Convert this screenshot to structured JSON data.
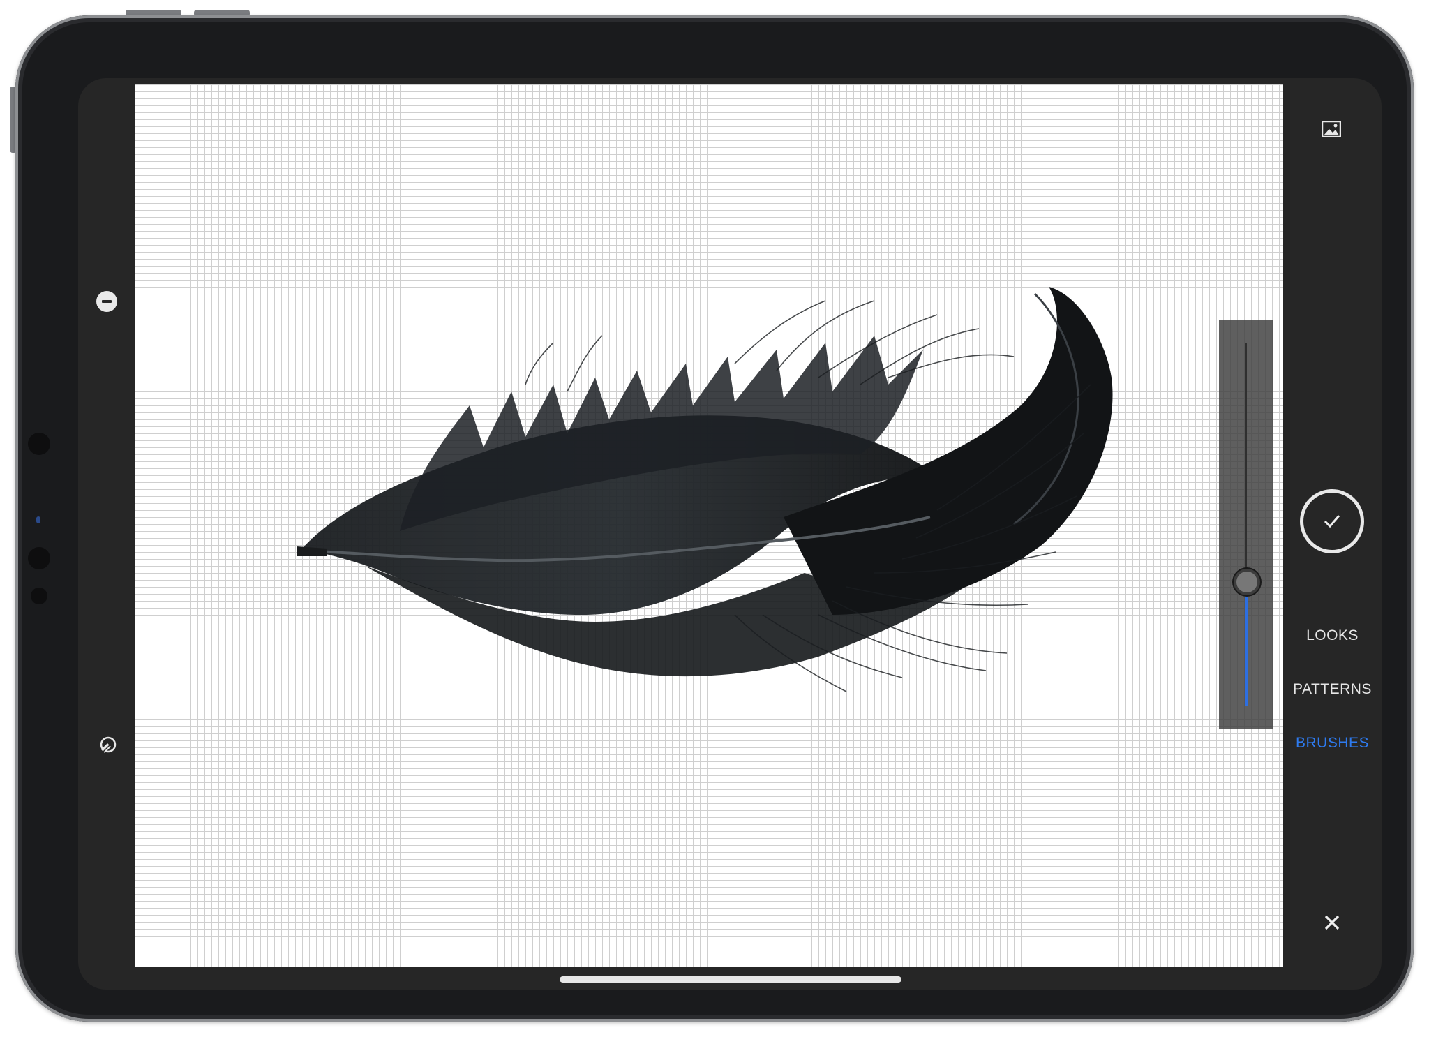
{
  "app": {
    "panel": {
      "menu": [
        {
          "label": "LOOKS",
          "active": false
        },
        {
          "label": "PATTERNS",
          "active": false
        },
        {
          "label": "BRUSHES",
          "active": true
        }
      ],
      "confirm_icon": "checkmark-icon",
      "image_icon": "image-icon",
      "close_icon": "close-icon"
    },
    "tools": {
      "subtract_icon": "minus-circle-icon",
      "eraser_icon": "eraser-brush-icon"
    },
    "brush_slider": {
      "level": 0.34
    },
    "colors": {
      "accent": "#2e7bf0",
      "panel_bg": "#262626",
      "menu_text": "#e6e6e6"
    }
  }
}
